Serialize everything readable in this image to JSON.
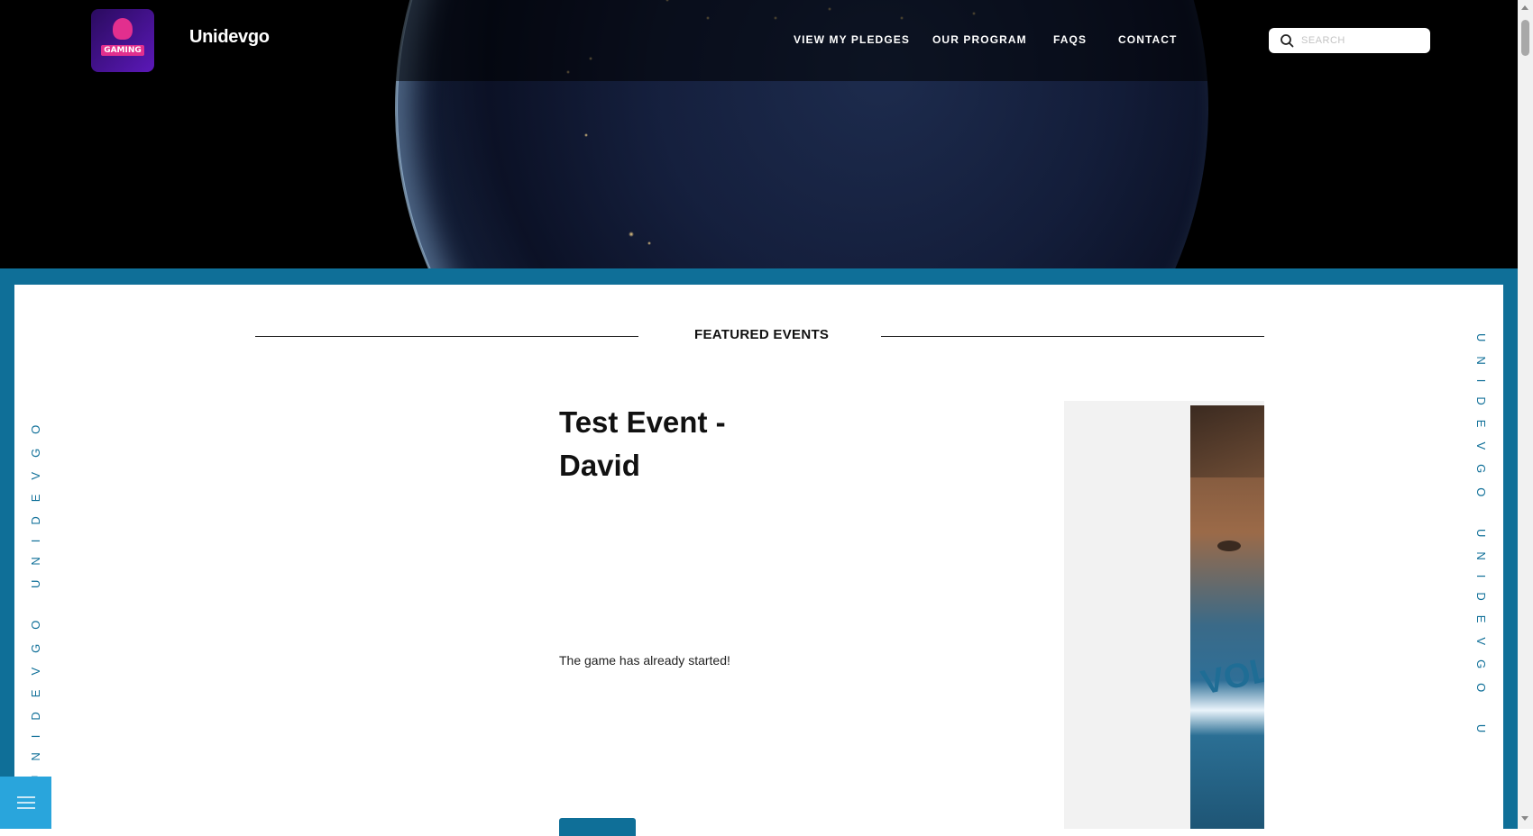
{
  "brand": {
    "name": "Unidevgo",
    "logo_text": "GAMING"
  },
  "nav": {
    "items": [
      {
        "label": "VIEW MY PLEDGES"
      },
      {
        "label": "OUR PROGRAM"
      },
      {
        "label": "FAQS"
      },
      {
        "label": "CONTACT"
      }
    ]
  },
  "search": {
    "placeholder": "SEARCH",
    "value": ""
  },
  "side_text": {
    "left": "UNIDEVGO UNIDEVGO",
    "right": "UNIDEVGO UNIDEVGO U"
  },
  "section": {
    "title": "FEATURED EVENTS"
  },
  "event": {
    "title": "Test Event - David",
    "status": "The game has already started!"
  },
  "poster": {
    "text": "VOL"
  },
  "colors": {
    "frame_blue": "#0f6f98",
    "menu_blue": "#29a5dc",
    "logo_purple": "#5b18b8"
  },
  "icons": [
    "search-icon",
    "menu-icon",
    "gaming-logo-icon"
  ]
}
